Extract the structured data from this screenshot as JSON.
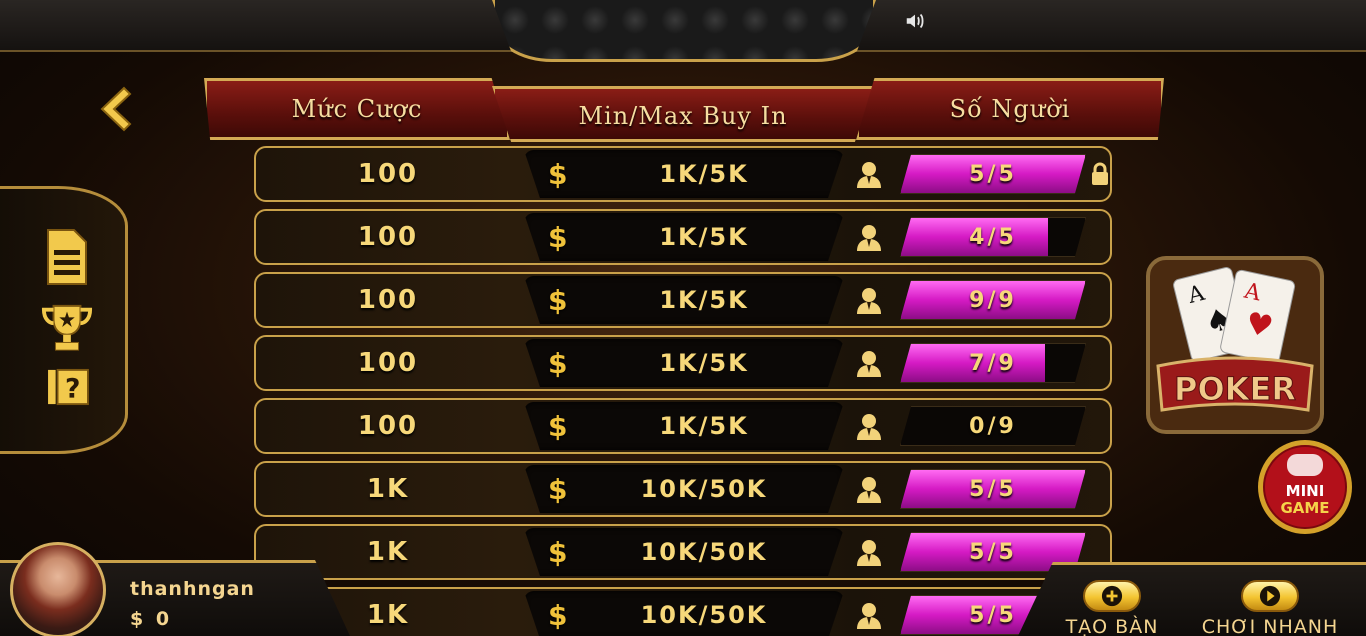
{
  "header": {
    "tabs": [
      {
        "label": "Mức Cược"
      },
      {
        "label": "Min/Max Buy In"
      },
      {
        "label": "Số Người"
      }
    ]
  },
  "table": {
    "rows": [
      {
        "bet": "100",
        "buyin": "1K/5K",
        "players": "5/5",
        "fill": 1.0,
        "locked": true
      },
      {
        "bet": "100",
        "buyin": "1K/5K",
        "players": "4/5",
        "fill": 0.8,
        "locked": false
      },
      {
        "bet": "100",
        "buyin": "1K/5K",
        "players": "9/9",
        "fill": 1.0,
        "locked": false
      },
      {
        "bet": "100",
        "buyin": "1K/5K",
        "players": "7/9",
        "fill": 0.78,
        "locked": false
      },
      {
        "bet": "100",
        "buyin": "1K/5K",
        "players": "0/9",
        "fill": 0.0,
        "locked": false
      },
      {
        "bet": "1K",
        "buyin": "10K/50K",
        "players": "5/5",
        "fill": 1.0,
        "locked": false
      },
      {
        "bet": "1K",
        "buyin": "10K/50K",
        "players": "5/5",
        "fill": 1.0,
        "locked": false
      },
      {
        "bet": "1K",
        "buyin": "10K/50K",
        "players": "5/5",
        "fill": 1.0,
        "locked": false
      }
    ],
    "currency_symbol": "$"
  },
  "sidebar": {
    "items": [
      {
        "icon": "document-icon"
      },
      {
        "icon": "trophy-icon"
      },
      {
        "icon": "help-icon"
      }
    ]
  },
  "game": {
    "logo_text": "POKER"
  },
  "mini_game": {
    "line1": "MINI",
    "line2": "GAME"
  },
  "user": {
    "name": "thanhngan",
    "balance": "$ 0"
  },
  "actions": [
    {
      "label": "TẠO BÀN",
      "icon": "plus-icon"
    },
    {
      "label": "CHƠI NHANH",
      "icon": "play-icon"
    }
  ],
  "colors": {
    "accent": "#c9a14a",
    "bar": "#d51ac4",
    "text": "#f7d87a"
  }
}
